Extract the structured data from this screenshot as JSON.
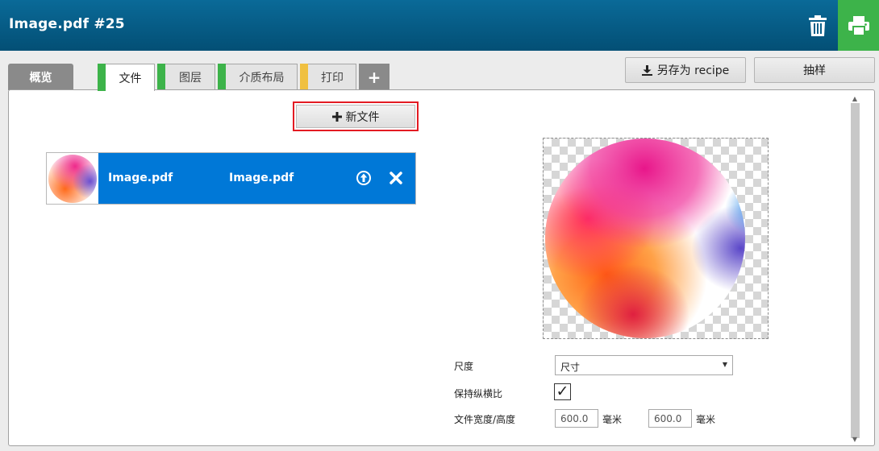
{
  "header": {
    "title": "Image.pdf #25",
    "trash_icon": "trash-icon",
    "print_icon": "printer-icon",
    "print_color": "#3db34a"
  },
  "tabs": {
    "overview": "概览",
    "items": [
      {
        "label": "文件",
        "marker": "#3db34a",
        "active": true
      },
      {
        "label": "图层",
        "marker": "#3db34a",
        "active": false
      },
      {
        "label": "介质布局",
        "marker": "#3db34a",
        "active": false
      },
      {
        "label": "打印",
        "marker": "#f0c040",
        "active": false
      }
    ],
    "add_label": "+"
  },
  "toolbar": {
    "save_recipe_label": "另存为 recipe",
    "sample_label": "抽样"
  },
  "files": {
    "new_file_label": "新文件",
    "rows": [
      {
        "name": "Image.pdf",
        "name2": "Image.pdf"
      }
    ]
  },
  "settings": {
    "scale_label": "尺度",
    "scale_value": "尺寸",
    "keep_ratio_label": "保持纵横比",
    "keep_ratio_checked": "✓",
    "size_label": "文件宽度/高度",
    "width_value": "600.0",
    "height_value": "600.0",
    "unit": "毫米"
  }
}
